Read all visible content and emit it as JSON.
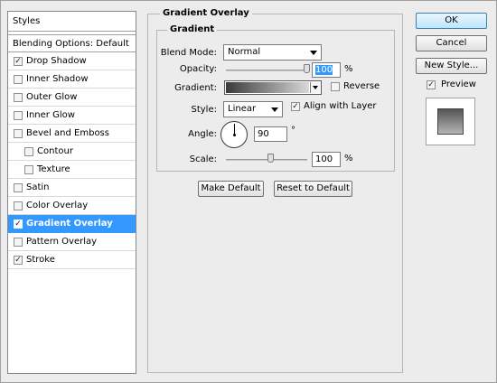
{
  "styles_panel": {
    "title": "Styles",
    "blending_options": "Blending Options: Default",
    "items": [
      {
        "label": "Drop Shadow",
        "checked": true,
        "sub": false,
        "active": false
      },
      {
        "label": "Inner Shadow",
        "checked": false,
        "sub": false,
        "active": false
      },
      {
        "label": "Outer Glow",
        "checked": false,
        "sub": false,
        "active": false
      },
      {
        "label": "Inner Glow",
        "checked": false,
        "sub": false,
        "active": false
      },
      {
        "label": "Bevel and Emboss",
        "checked": false,
        "sub": false,
        "active": false
      },
      {
        "label": "Contour",
        "checked": false,
        "sub": true,
        "active": false
      },
      {
        "label": "Texture",
        "checked": false,
        "sub": true,
        "active": false
      },
      {
        "label": "Satin",
        "checked": false,
        "sub": false,
        "active": false
      },
      {
        "label": "Color Overlay",
        "checked": false,
        "sub": false,
        "active": false
      },
      {
        "label": "Gradient Overlay",
        "checked": true,
        "sub": false,
        "active": true
      },
      {
        "label": "Pattern Overlay",
        "checked": false,
        "sub": false,
        "active": false
      },
      {
        "label": "Stroke",
        "checked": true,
        "sub": false,
        "active": false
      }
    ]
  },
  "gradient_overlay": {
    "group_title": "Gradient Overlay",
    "subgroup_title": "Gradient",
    "blend_mode_label": "Blend Mode:",
    "blend_mode_value": "Normal",
    "opacity_label": "Opacity:",
    "opacity_value": "100",
    "opacity_unit": "%",
    "opacity_fraction": 1.0,
    "gradient_label": "Gradient:",
    "gradient_colors": [
      "#3a3a3a",
      "#d8d8d8"
    ],
    "reverse_label": "Reverse",
    "reverse_checked": false,
    "style_label": "Style:",
    "style_value": "Linear",
    "align_label": "Align with Layer",
    "align_checked": true,
    "angle_label": "Angle:",
    "angle_value": "90",
    "angle_unit": "°",
    "scale_label": "Scale:",
    "scale_value": "100",
    "scale_unit": "%",
    "scale_fraction": 0.55,
    "make_default": "Make Default",
    "reset_default": "Reset to Default"
  },
  "right_buttons": {
    "ok": "OK",
    "cancel": "Cancel",
    "new_style": "New Style...",
    "preview_label": "Preview",
    "preview_checked": true
  },
  "colors": {
    "accent": "#3399ff",
    "dialog_bg": "#ececec"
  }
}
